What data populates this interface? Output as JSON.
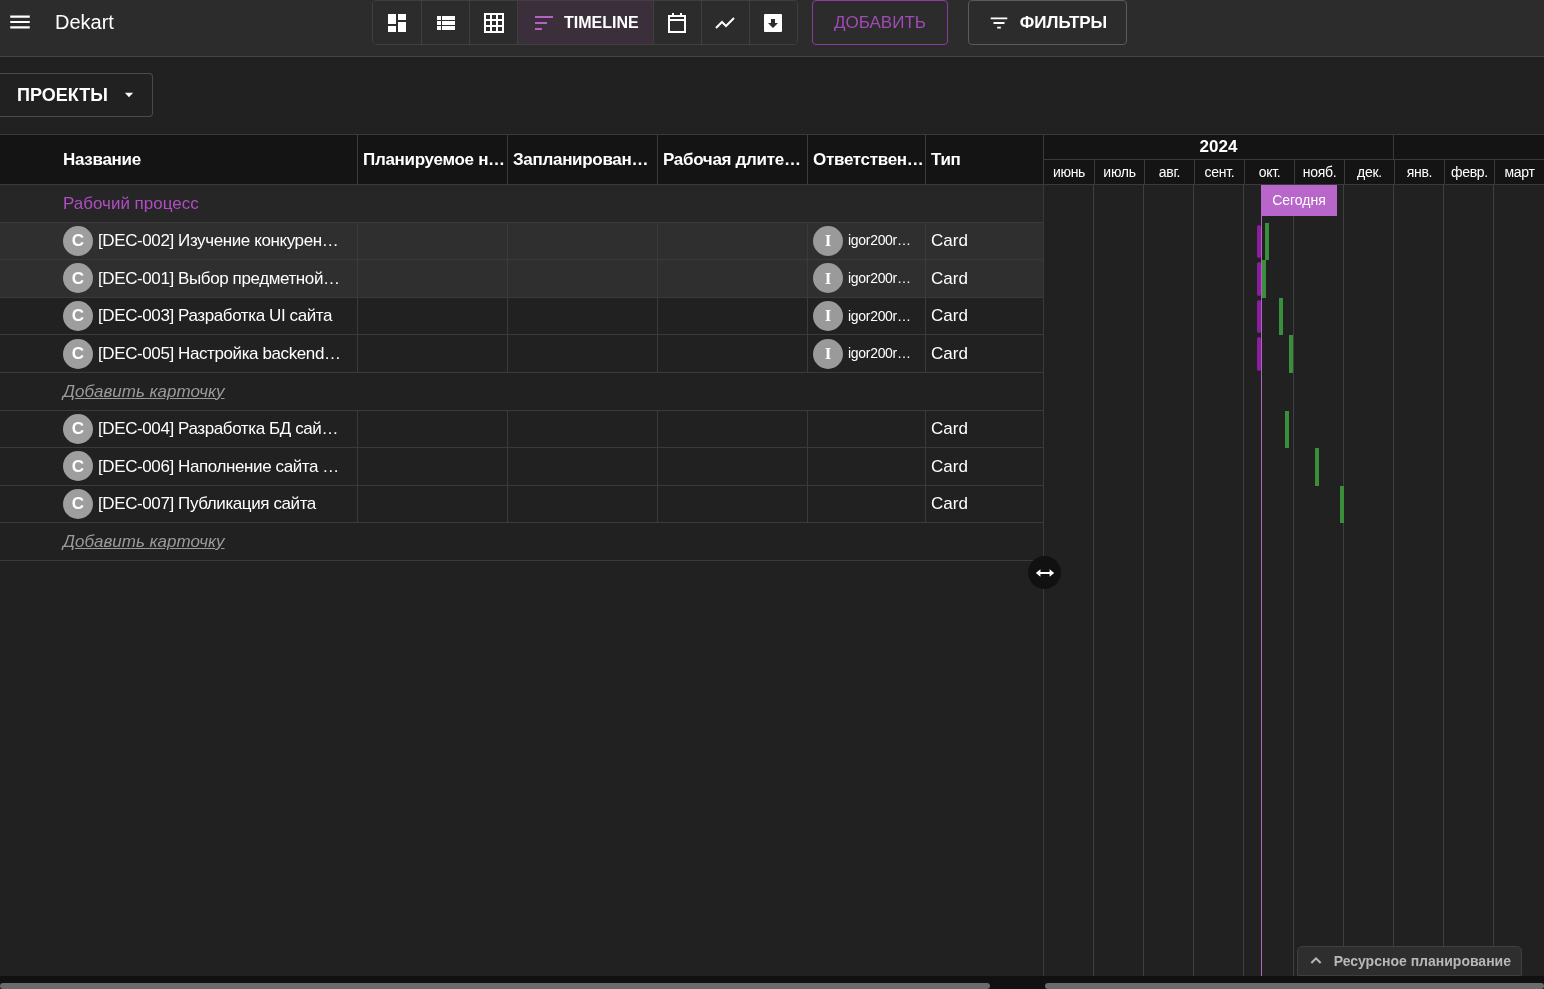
{
  "app": {
    "title": "Dekart"
  },
  "view_tabs": [
    {
      "kind": "board",
      "selected": false
    },
    {
      "kind": "list",
      "selected": false
    },
    {
      "kind": "table",
      "selected": false
    },
    {
      "kind": "timeline",
      "label": "TIMELINE",
      "selected": true
    },
    {
      "kind": "calendar",
      "selected": false
    },
    {
      "kind": "chart",
      "selected": false
    },
    {
      "kind": "archive",
      "selected": false
    }
  ],
  "add_button": "ДОБАВИТЬ",
  "filters_button": "ФИЛЬТРЫ",
  "projects_dropdown": "ПРОЕКТЫ",
  "table": {
    "columns": [
      "Название",
      "Планируемое н…",
      "Запланирован…",
      "Рабочая длите…",
      "Ответствен…",
      "Тип"
    ],
    "groups": [
      {
        "title": "Рабочий процесс",
        "add_link": "Добавить карточку",
        "rows": [
          {
            "avatar": "C",
            "name": "[DEC-002] Изучение конкурен…",
            "assignee": {
              "initial": "I",
              "name": "igor200r…"
            },
            "type": "Card",
            "highlighted": true
          },
          {
            "avatar": "C",
            "name": "[DEC-001] Выбор предметной…",
            "assignee": {
              "initial": "I",
              "name": "igor200r…"
            },
            "type": "Card",
            "highlighted": true
          },
          {
            "avatar": "C",
            "name": "[DEC-003] Разработка UI сайта",
            "assignee": {
              "initial": "I",
              "name": "igor200r…"
            },
            "type": "Card",
            "highlighted": false
          },
          {
            "avatar": "C",
            "name": "[DEC-005] Настройка backend…",
            "assignee": {
              "initial": "I",
              "name": "igor200r…"
            },
            "type": "Card",
            "highlighted": false
          }
        ]
      },
      {
        "add_link": "Добавить карточку",
        "rows": [
          {
            "avatar": "C",
            "name": "[DEC-004] Разработка БД сай…",
            "type": "Card",
            "highlighted": false
          },
          {
            "avatar": "C",
            "name": "[DEC-006] Наполнение сайта …",
            "type": "Card",
            "highlighted": false
          },
          {
            "avatar": "C",
            "name": "[DEC-007] Публикация сайта",
            "type": "Card",
            "highlighted": false
          }
        ]
      }
    ]
  },
  "timeline": {
    "year": "2024",
    "months": [
      "июнь",
      "июль",
      "авг.",
      "сент.",
      "окт.",
      "нояб.",
      "дек.",
      "янв.",
      "февр.",
      "март"
    ],
    "today_label": "Сегодня"
  },
  "resource_panel": {
    "label": "Ресурсное планирование",
    "expanded": false
  }
}
